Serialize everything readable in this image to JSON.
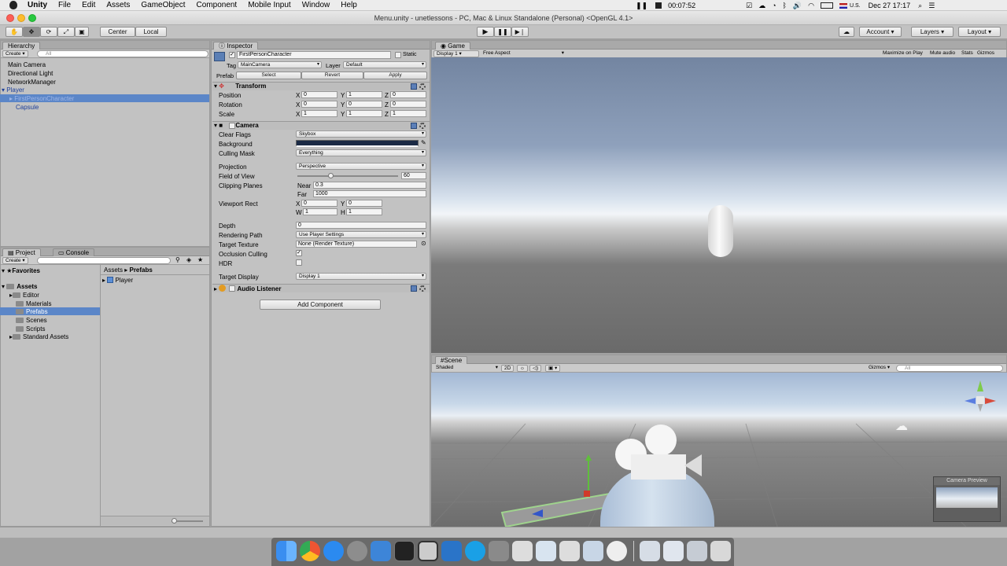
{
  "menubar": {
    "items": [
      "Unity",
      "File",
      "Edit",
      "Assets",
      "GameObject",
      "Component",
      "Mobile Input",
      "Window",
      "Help"
    ],
    "timer": "00:07:52",
    "input_source": "U.S.",
    "datetime": "Dec 27  17:17"
  },
  "window": {
    "title": "Menu.unity - unetlessons - PC, Mac & Linux Standalone (Personal) <OpenGL 4.1>"
  },
  "toolbar": {
    "pivot_center": "Center",
    "pivot_local": "Local",
    "account": "Account",
    "layers": "Layers",
    "layout": "Layout"
  },
  "hierarchy": {
    "tab": "Hierarchy",
    "create": "Create",
    "search_placeholder": "All",
    "items": [
      "Main Camera",
      "Directional Light",
      "NetworkManager",
      "Player",
      "FirstPersonCharacter",
      "Capsule"
    ]
  },
  "inspector": {
    "tab": "Inspector",
    "object_name": "FirstPersonCharacter",
    "static_label": "Static",
    "tag_label": "Tag",
    "tag_value": "MainCamera",
    "layer_label": "Layer",
    "layer_value": "Default",
    "prefab_label": "Prefab",
    "prefab_select": "Select",
    "prefab_revert": "Revert",
    "prefab_apply": "Apply",
    "transform": {
      "title": "Transform",
      "rows": [
        {
          "label": "Position",
          "x": "0",
          "y": "1",
          "z": "0"
        },
        {
          "label": "Rotation",
          "x": "0",
          "y": "0",
          "z": "0"
        },
        {
          "label": "Scale",
          "x": "1",
          "y": "1",
          "z": "1"
        }
      ]
    },
    "camera": {
      "title": "Camera",
      "clear_flags_label": "Clear Flags",
      "clear_flags": "Skybox",
      "background_label": "Background",
      "background_color": "#1b2a45",
      "culling_mask_label": "Culling Mask",
      "culling_mask": "Everything",
      "projection_label": "Projection",
      "projection": "Perspective",
      "fov_label": "Field of View",
      "fov": "60",
      "fov_fraction": 0.33,
      "clipping_label": "Clipping Planes",
      "near_label": "Near",
      "near": "0.3",
      "far_label": "Far",
      "far": "1000",
      "viewport_label": "Viewport Rect",
      "vp_x": "0",
      "vp_y": "0",
      "vp_w": "1",
      "vp_h": "1",
      "depth_label": "Depth",
      "depth": "0",
      "rendering_path_label": "Rendering Path",
      "rendering_path": "Use Player Settings",
      "target_texture_label": "Target Texture",
      "target_texture": "None (Render Texture)",
      "occlusion_label": "Occlusion Culling",
      "hdr_label": "HDR",
      "target_display_label": "Target Display",
      "target_display": "Display 1"
    },
    "audio_listener": "Audio Listener",
    "add_component": "Add Component"
  },
  "project": {
    "tab_project": "Project",
    "tab_console": "Console",
    "create": "Create",
    "favorites": "Favorites",
    "assets": "Assets",
    "folders": [
      "Editor",
      "Materials",
      "Prefabs",
      "Scenes",
      "Scripts",
      "Standard Assets"
    ],
    "breadcrumb_root": "Assets",
    "breadcrumb_current": "Prefabs",
    "files": [
      "Player"
    ]
  },
  "game": {
    "tab": "Game",
    "display": "Display 1",
    "aspect": "Free Aspect",
    "maximize": "Maximize on Play",
    "mute": "Mute audio",
    "stats": "Stats",
    "gizmos": "Gizmos"
  },
  "scene": {
    "tab": "Scene",
    "shading": "Shaded",
    "mode_2d": "2D",
    "gizmos": "Gizmos",
    "search_placeholder": "All",
    "camera_preview": "Camera Preview"
  },
  "colors": {
    "selection": "#5b86c8",
    "panel": "#c2c2c2"
  }
}
